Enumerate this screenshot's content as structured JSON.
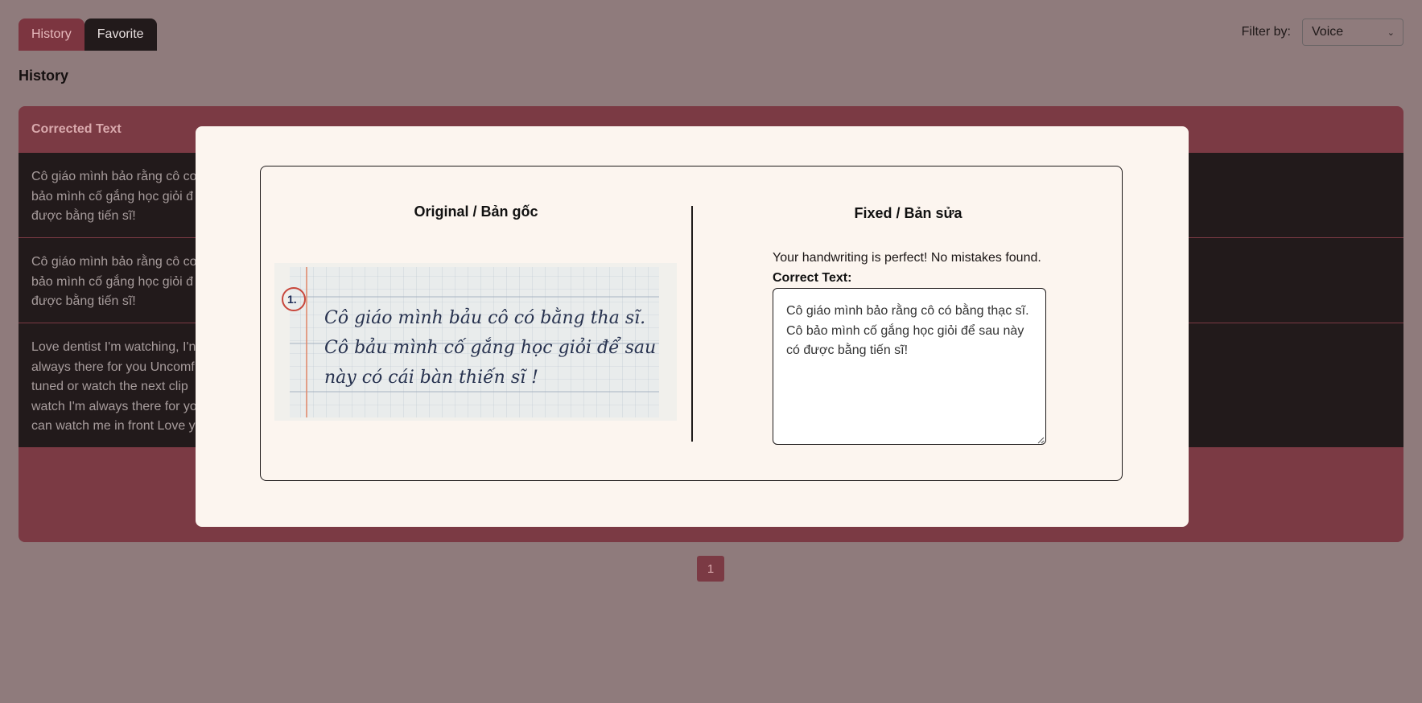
{
  "tabs": {
    "history": "History",
    "favorite": "Favorite"
  },
  "filter": {
    "label": "Filter by:",
    "value": "Voice"
  },
  "section_title": "History",
  "table": {
    "headers": [
      "Corrected Text"
    ],
    "rows": [
      [
        "Cô giáo mình bảo rằng cô co",
        "bảo mình cố gắng học giỏi đ",
        "được bằng tiến sĩ!"
      ],
      [
        "Cô giáo mình bảo rằng cô co",
        "bảo mình cố gắng học giỏi đ",
        "được bằng tiến sĩ!"
      ],
      [
        "Love dentist I'm watching, I'n",
        "always there for you Uncomf",
        "tuned or watch the next clip",
        "watch I'm always there for yo",
        "can watch me in front Love y"
      ]
    ]
  },
  "pagination": {
    "current": "1"
  },
  "modal": {
    "original_title": "Original / Bản gốc",
    "fixed_title": "Fixed / Bản sửa",
    "result_message": "Your handwriting is perfect! No mistakes found.",
    "correct_label": "Correct Text:",
    "correct_text": "Cô giáo mình bảo rằng cô có bằng thạc sĩ. Cô bảo mình cố gắng học giỏi để sau này có được bằng tiến sĩ!",
    "handwriting_lines": [
      "Cô giáo mình bảu cô có bằng tha sĩ.",
      "Cô bảu mình cố gắng học giỏi để sau",
      "này có cái bàn thiến sĩ !"
    ]
  },
  "colors": {
    "backdrop": "#8f7b7c",
    "accent": "#7b3a44",
    "dark_row": "#221a1b",
    "modal_bg": "#fcf5ef"
  },
  "icons": {
    "select_chevron": "chevron-down-icon",
    "textarea_resize": "resize-grip-icon"
  }
}
